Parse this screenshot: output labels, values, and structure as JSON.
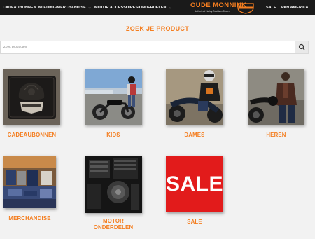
{
  "nav": {
    "items": [
      {
        "label": "CADEAUBONNEN"
      },
      {
        "label": "KLEDING/MERCHANDISE",
        "chevron": "chevron-down-icon"
      },
      {
        "label": "MOTOR ACCESSOIRES/ONDERDELEN",
        "chevron": "chevron-down-icon"
      },
      {
        "label": "SALE"
      },
      {
        "label": "PAN AMERICA"
      }
    ],
    "logo_text": "OUDE MONNINK",
    "logo_sub": "Authorized Harley-Davidson Dealer"
  },
  "main": {
    "title": "ZOEK JE PRODUCT",
    "search": {
      "placeholder": "Zoek producten",
      "value": "",
      "icon": "search-icon"
    },
    "categories": [
      {
        "label": "CADEAUBONNEN"
      },
      {
        "label": "KIDS"
      },
      {
        "label": "DAMES"
      },
      {
        "label": "HEREN"
      },
      {
        "label": "MERCHANDISE"
      },
      {
        "label": "MOTOR ONDERDELEN"
      },
      {
        "label": "SALE",
        "image_text": "SALE"
      }
    ]
  },
  "colors": {
    "accent": "#f47e20",
    "navbar": "#1a1a1a",
    "background": "#f2f2f2",
    "sale_red": "#e21b1b"
  }
}
